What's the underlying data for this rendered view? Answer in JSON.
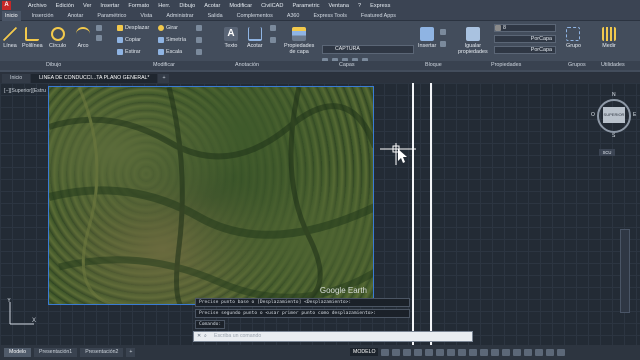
{
  "menubar": {
    "items": [
      "Archivo",
      "Edición",
      "Ver",
      "Insertar",
      "Formato",
      "Herr.",
      "Dibujo",
      "Acotar",
      "Modificar",
      "CivilCAD",
      "Parametric",
      "Ventana",
      "?",
      "Express"
    ]
  },
  "ribbon_tabs": [
    "Inicio",
    "Inserción",
    "Anotar",
    "Paramétrico",
    "Vista",
    "Administrar",
    "Salida",
    "Complementos",
    "A360",
    "Express Tools",
    "Featured Apps"
  ],
  "ribbon": {
    "linea": "Línea",
    "polilinea": "Polilínea",
    "circulo": "Círculo",
    "arco": "Arco",
    "desplazar": "Desplazar",
    "girar": "Girar",
    "copiar": "Copiar",
    "simetria": "Simetría",
    "estirar": "Estirar",
    "escala": "Escala",
    "texto": "Texto",
    "acotar": "Acotar",
    "propiedades_capa": "Propiedades\nde capa",
    "layer_name": "CAPTURA",
    "insertar": "Insertar",
    "igualar": "Igualar\npropiedades",
    "porcapa1": "PorCapa",
    "porcapa2": "PorCapa",
    "porcapa3": "PorCapa",
    "color_value": "8",
    "grupo": "Grupo",
    "medir": "Medir"
  },
  "panel_labels": {
    "dibujo": "Dibujo",
    "modificar": "Modificar",
    "anotacion": "Anotación",
    "capas": "Capas",
    "bloque": "Bloque",
    "propiedades": "Propiedades",
    "grupos": "Grupos",
    "utilidades": "Utilidades"
  },
  "file_tabs": [
    "Inicio",
    "LINEA DE CONDUCCI...TA PLANO GENERAL*"
  ],
  "viewport_label": "[−][Superior][Estru",
  "watermark": "Google Earth",
  "navcube": {
    "n": "N",
    "s": "S",
    "e": "E",
    "o": "O",
    "center": "SUPERIOR",
    "scu": "SCU"
  },
  "command_history": [
    "Precise punto base o [Desplazamiento] <Desplazamiento>:",
    "Precise segundo punto o <usar primer punto como desplazamiento>:",
    "Comando:"
  ],
  "command_placeholder": "Escriba un comando",
  "layout_tabs": [
    "Modelo",
    "Presentación1",
    "Presentación2"
  ],
  "status": {
    "model": "MODELO"
  },
  "colors": {
    "accent": "#3a7bd5",
    "canvas": "#232b35",
    "ribbon": "#434d5c"
  }
}
